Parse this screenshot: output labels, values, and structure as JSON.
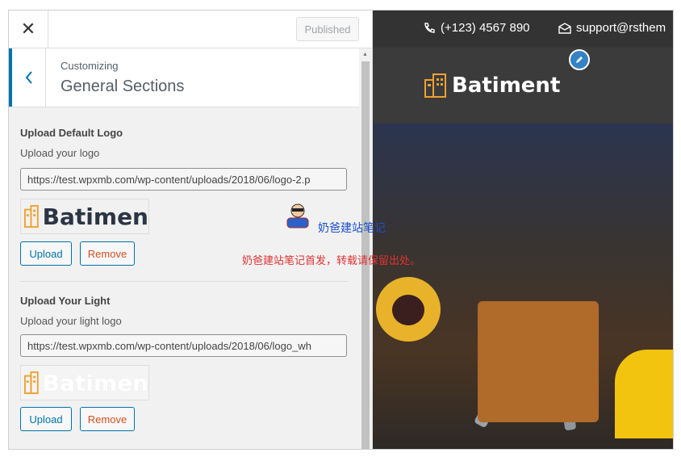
{
  "topbar": {
    "close_icon": "close-icon",
    "publish_label": "Published"
  },
  "section": {
    "breadcrumb": "Customizing",
    "title": "General Sections"
  },
  "controls": [
    {
      "title": "Upload Default Logo",
      "description": "Upload your logo",
      "url": "https://test.wpxmb.com/wp-content/uploads/2018/06/logo-2.p",
      "preview_text": "Batimen",
      "upload_label": "Upload",
      "remove_label": "Remove"
    },
    {
      "title": "Upload Your Light",
      "description": "Upload your light logo",
      "url": "https://test.wpxmb.com/wp-content/uploads/2018/06/logo_wh",
      "preview_text": "Batimen",
      "upload_label": "Upload",
      "remove_label": "Remove"
    }
  ],
  "preview": {
    "phone": "(+123) 4567 890",
    "email": "support@rsthem",
    "logo_text": "Batiment"
  },
  "watermark": {
    "brand": "奶爸建站笔记",
    "notice": "奶爸建站笔记首发，转载请保留出处。"
  },
  "colors": {
    "accent": "#0073aa",
    "remove": "#d54e21",
    "logo_orange": "#f0a030"
  }
}
